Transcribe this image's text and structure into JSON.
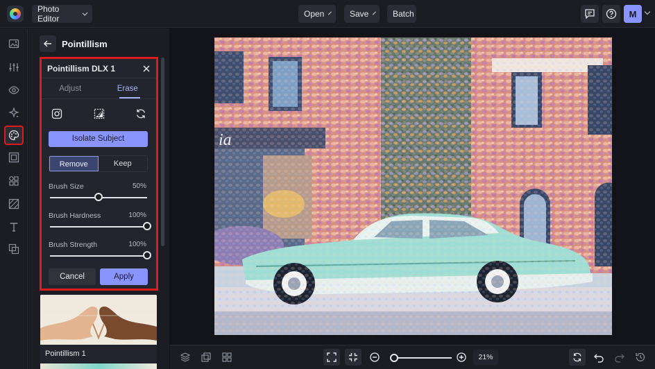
{
  "app": {
    "name": "Photo Editor"
  },
  "topbar": {
    "open_label": "Open",
    "save_label": "Save",
    "batch_label": "Batch",
    "avatar_initial": "M"
  },
  "panel": {
    "title": "Pointillism",
    "card": {
      "title": "Pointillism DLX 1",
      "tabs": [
        {
          "label": "Adjust"
        },
        {
          "label": "Erase",
          "active": true
        }
      ],
      "isolate_label": "Isolate Subject",
      "mode": {
        "remove": "Remove",
        "keep": "Keep",
        "selected": "Remove"
      },
      "sliders": [
        {
          "label": "Brush Size",
          "value_text": "50%",
          "value": 0.5
        },
        {
          "label": "Brush Hardness",
          "value_text": "100%",
          "value": 1.0
        },
        {
          "label": "Brush Strength",
          "value_text": "100%",
          "value": 1.0
        }
      ],
      "cancel_label": "Cancel",
      "apply_label": "Apply"
    },
    "presets": [
      {
        "label": "Pointillism 1"
      }
    ]
  },
  "bottombar": {
    "zoom_text": "21%",
    "zoom_value": 0.06
  },
  "colors": {
    "accent": "#8a94ff",
    "highlight": "#e01b1b",
    "background": "#1b1d23"
  }
}
